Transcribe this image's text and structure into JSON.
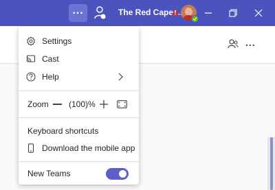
{
  "titlebar": {
    "more_label": "...",
    "org_name": "The Red Cape ...",
    "colors": {
      "bar": "#4b53bc",
      "active_button": "#6d73d3",
      "warning": "#c4314b",
      "presence": "#6bb700"
    }
  },
  "menu": {
    "settings_label": "Settings",
    "cast_label": "Cast",
    "help_label": "Help",
    "zoom_label": "Zoom",
    "zoom_value": "(100)%",
    "keyboard_shortcuts_label": "Keyboard shortcuts",
    "download_mobile_label": "Download the mobile app",
    "new_teams_label": "New Teams",
    "new_teams_enabled": true,
    "toggle_color": "#5b5fc7"
  },
  "content_header": {
    "more_label": "..."
  }
}
